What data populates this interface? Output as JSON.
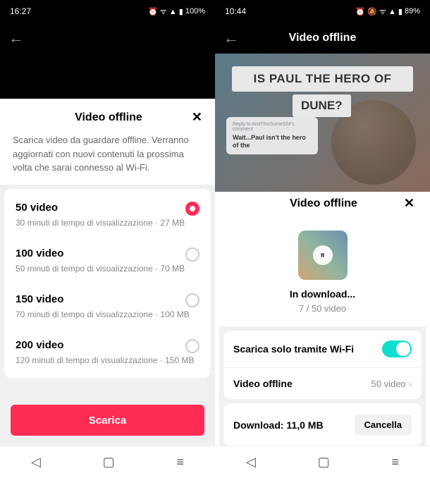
{
  "left": {
    "status": {
      "time": "16:27",
      "battery": "100%",
      "icons": "⏰ ᯤ ▲ ▮"
    },
    "sheet": {
      "title": "Video offline",
      "close": "✕",
      "description": "Scarica video da guardare offline. Verranno aggiornati con nuovi contenuti la prossima volta che sarai connesso al Wi-Fi.",
      "options": [
        {
          "title": "50 video",
          "sub": "30 minuti di tempo di visualizzazione · 27 MB",
          "selected": true
        },
        {
          "title": "100 video",
          "sub": "50 minuti di tempo di visualizzazione · 70 MB",
          "selected": false
        },
        {
          "title": "150 video",
          "sub": "70 minuti di tempo di visualizzazione · 100 MB",
          "selected": false
        },
        {
          "title": "200 video",
          "sub": "120 minuti di tempo di visualizzazione · 150 MB",
          "selected": false
        }
      ],
      "button": "Scarica"
    }
  },
  "right": {
    "status": {
      "time": "10:44",
      "battery": "89%",
      "icons": "⏰ 🔕 ᯤ ▲ ▮"
    },
    "header": {
      "title": "Video offline"
    },
    "video": {
      "overlay1": "IS PAUL THE HERO OF",
      "overlay2": "DUNE?",
      "reply_label": "Reply to AintThisSomeShit's comment",
      "reply_text": "Wait...Paul isn't the hero of the"
    },
    "sheet": {
      "title": "Video offline",
      "close": "✕",
      "pause": "⏸",
      "status": "In download...",
      "progress": "7 / 50 video",
      "wifi_label": "Scarica solo tramite Wi-Fi",
      "offline_label": "Video offline",
      "offline_value": "50 video",
      "download_label": "Download: 11,0 MB",
      "cancel": "Cancella"
    }
  },
  "nav": {
    "back": "◁",
    "home": "▢",
    "recent": "≡"
  }
}
